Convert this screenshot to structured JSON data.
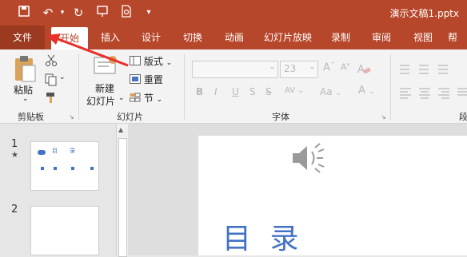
{
  "window": {
    "title": "演示文稿1.pptx"
  },
  "quick_access": [
    {
      "name": "save-icon",
      "glyph": "💾"
    },
    {
      "name": "undo-icon",
      "glyph": "↶"
    },
    {
      "name": "redo-icon",
      "glyph": "↻"
    },
    {
      "name": "present-icon",
      "glyph": "⊡"
    },
    {
      "name": "print-preview-icon",
      "glyph": "🔍"
    },
    {
      "name": "customize-icon",
      "glyph": "▾"
    }
  ],
  "tabs": [
    "文件",
    "开始",
    "插入",
    "设计",
    "切换",
    "动画",
    "幻灯片放映",
    "录制",
    "审阅",
    "视图",
    "帮"
  ],
  "ribbon": {
    "clipboard": {
      "paste": "粘贴",
      "label": "剪贴板"
    },
    "slides": {
      "new_slide_line1": "新建",
      "new_slide_line2": "幻灯片",
      "layout": "版式",
      "reset": "重置",
      "section": "节",
      "label": "幻灯片"
    },
    "font": {
      "size": "23",
      "bold": "B",
      "italic": "I",
      "underline": "U",
      "strike": "S",
      "shadow": "S",
      "spacing": "AV",
      "case": "Aa",
      "clear": "A",
      "label": "字体"
    },
    "paragraph": {
      "label": "段"
    }
  },
  "thumbnails": [
    {
      "num": "1",
      "star": "★",
      "title_chars": [
        "目",
        "录"
      ]
    },
    {
      "num": "2"
    }
  ],
  "slide": {
    "title": "目 录"
  },
  "colors": {
    "accent": "#b7472a",
    "file_tab": "#9b3a21",
    "slide_title": "#4472c4",
    "annotation_arrow": "#e8302a"
  }
}
